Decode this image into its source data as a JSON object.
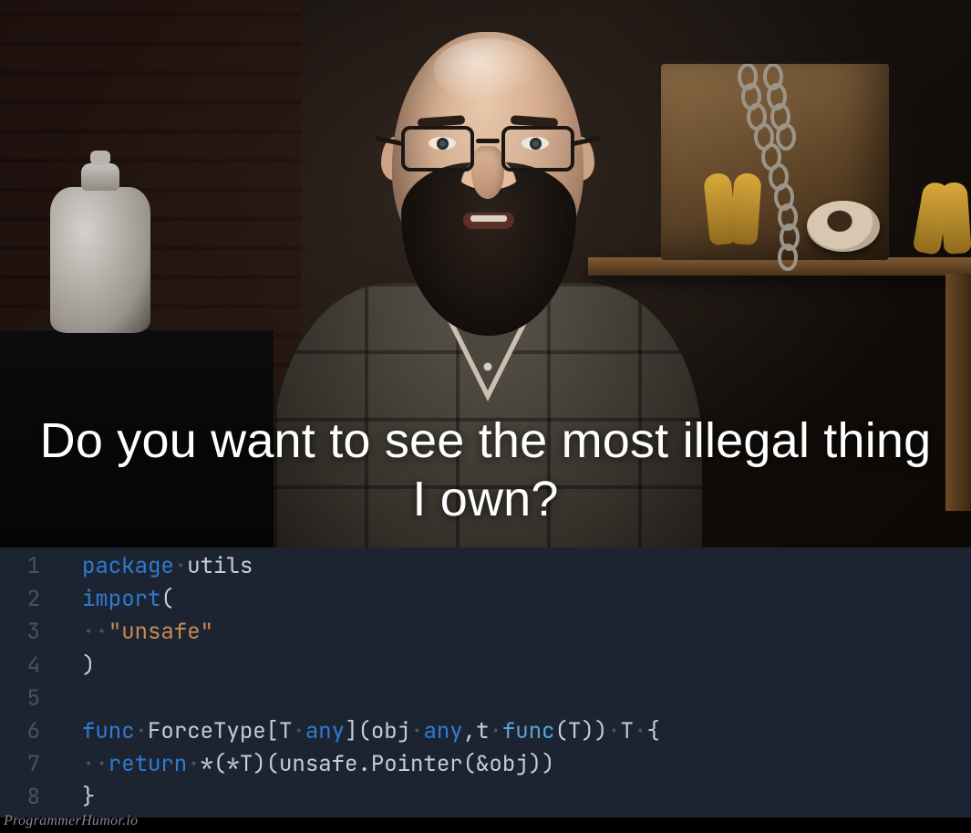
{
  "caption": "Do you want to see the most illegal thing I own?",
  "watermark": "ProgrammerHumor.io",
  "code": {
    "line_numbers": [
      "1",
      "2",
      "3",
      "4",
      "5",
      "6",
      "7",
      "8"
    ],
    "l1_kw": "package",
    "l1_name": "utils",
    "l2_kw": "import",
    "l2_paren": "(",
    "l3_str": "\"unsafe\"",
    "l4_paren": ")",
    "l6_kw_func": "func",
    "l6_name": "ForceType",
    "l6_lbrack": "[",
    "l6_T": "T",
    "l6_any1": "any",
    "l6_rbrack_lpar": "](",
    "l6_obj": "obj",
    "l6_any2": "any",
    "l6_comma": ",",
    "l6_t2": "t",
    "l6_func2": "func",
    "l6_lpar2": "(",
    "l6_T2": "T",
    "l6_rpar2": "))",
    "l6_T3": "T",
    "l6_brace": "{",
    "l7_kw": "return",
    "l7_body": "*(*T)(unsafe.Pointer(&obj))",
    "l8_brace": "}",
    "sp": "·",
    "sp2": "··"
  }
}
